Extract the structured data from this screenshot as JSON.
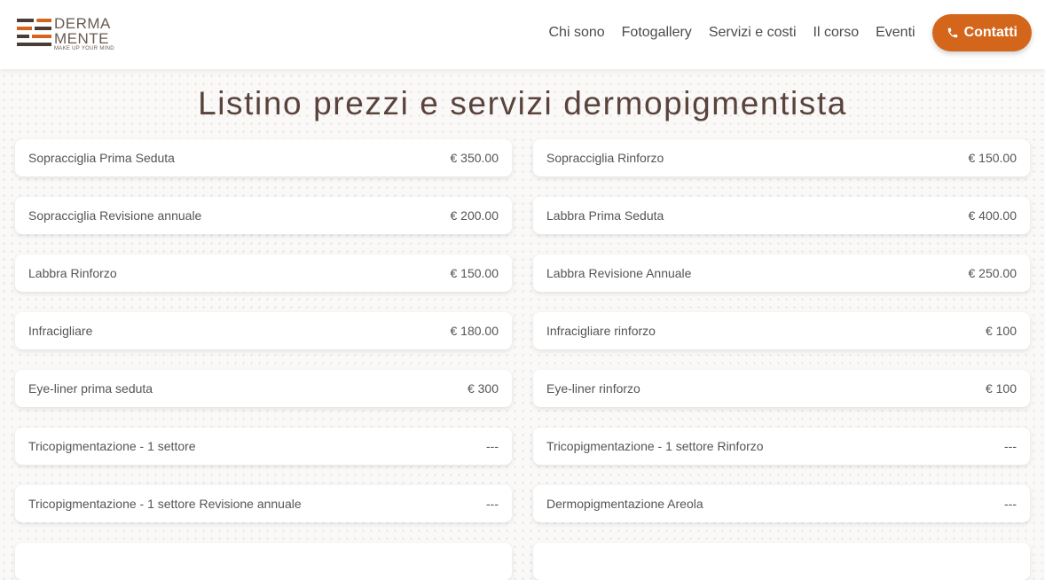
{
  "brand": {
    "line1": "DERMA",
    "line2": "MENTE",
    "tagline": "MAKE UP YOUR MIND",
    "colors": {
      "dark": "#4a3c36",
      "accent": "#d4661c"
    }
  },
  "nav": {
    "items": [
      "Chi sono",
      "Fotogallery",
      "Servizi e costi",
      "Il corso",
      "Eventi"
    ],
    "cta_label": "Contatti",
    "cta_icon": "phone-icon"
  },
  "page": {
    "title": "Listino prezzi e servizi dermopigmentista"
  },
  "services": [
    {
      "name": "Sopracciglia Prima Seduta",
      "price": "€ 350.00"
    },
    {
      "name": "Sopracciglia Rinforzo",
      "price": "€ 150.00"
    },
    {
      "name": "Sopracciglia Revisione annuale",
      "price": "€ 200.00"
    },
    {
      "name": "Labbra Prima Seduta",
      "price": "€ 400.00"
    },
    {
      "name": "Labbra Rinforzo",
      "price": "€ 150.00"
    },
    {
      "name": "Labbra Revisione Annuale",
      "price": "€ 250.00"
    },
    {
      "name": "Infracigliare",
      "price": "€ 180.00"
    },
    {
      "name": "Infracigliare rinforzo",
      "price": "€ 100"
    },
    {
      "name": "Eye-liner prima seduta",
      "price": "€ 300"
    },
    {
      "name": "Eye-liner rinforzo",
      "price": "€ 100"
    },
    {
      "name": "Tricopigmentazione - 1 settore",
      "price": "---"
    },
    {
      "name": "Tricopigmentazione - 1 settore Rinforzo",
      "price": "---"
    },
    {
      "name": "Tricopigmentazione - 1 settore Revisione annuale",
      "price": "---"
    },
    {
      "name": "Dermopigmentazione Areola",
      "price": "---"
    },
    {
      "name": "",
      "price": ""
    },
    {
      "name": "",
      "price": ""
    }
  ]
}
